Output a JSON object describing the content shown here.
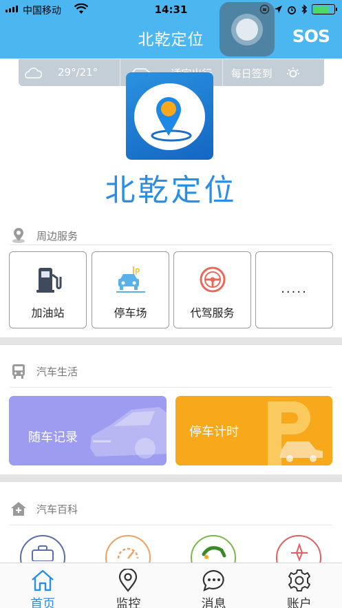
{
  "status_bar": {
    "carrier": "中国移动",
    "time": "14:31"
  },
  "header": {
    "title": "北乾定位",
    "sos_label": "SOS"
  },
  "info_bar": {
    "temperature": "29°/21°",
    "travel_advice": "适宜出行",
    "checkin_label": "每日签到"
  },
  "app": {
    "name": "北乾定位"
  },
  "nearby": {
    "title": "周边服务",
    "items": [
      {
        "label": "加油站",
        "icon": "gas-station-icon"
      },
      {
        "label": "停车场",
        "icon": "parking-icon"
      },
      {
        "label": "代驾服务",
        "icon": "steering-wheel-icon"
      },
      {
        "label": "·····",
        "icon": "more-icon"
      }
    ]
  },
  "car_life": {
    "title": "汽车生活",
    "cards": [
      {
        "label": "随车记录",
        "color": "#9d9cf0"
      },
      {
        "label": "停车计时",
        "color": "#f7a81b"
      }
    ]
  },
  "encyclopedia": {
    "title": "汽车百科",
    "icon_colors": [
      "#5a6ea8",
      "#f0a060",
      "#7ab84a",
      "#e06060"
    ]
  },
  "tabbar": {
    "tabs": [
      {
        "label": "首页",
        "icon": "home-icon",
        "active": true
      },
      {
        "label": "监控",
        "icon": "location-pin-icon",
        "active": false
      },
      {
        "label": "消息",
        "icon": "chat-icon",
        "active": false
      },
      {
        "label": "账户",
        "icon": "gear-icon",
        "active": false
      }
    ]
  },
  "colors": {
    "header_blue": "#4cb6f0",
    "brand_blue": "#2a8fe4",
    "accent_orange": "#f7a81b",
    "accent_purple": "#9d9cf0"
  }
}
